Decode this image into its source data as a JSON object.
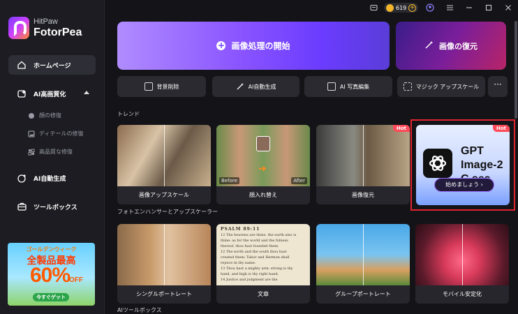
{
  "app": {
    "brand": "HitPaw",
    "product": "FotorPea"
  },
  "topbar": {
    "coins": "619"
  },
  "sidebar": {
    "items": [
      {
        "label": "ホームページ"
      },
      {
        "label": "AI高画質化"
      },
      {
        "label": "AI自動生成"
      },
      {
        "label": "ツールボックス"
      }
    ],
    "subitems": [
      {
        "label": "顔の修復"
      },
      {
        "label": "ディテールの修復"
      },
      {
        "label": "高品質な修復"
      }
    ],
    "promo": {
      "line1": "ゴールデンウィーク",
      "line2": "全製品最高",
      "percent": "60%",
      "off": "OFF",
      "button": "今すぐゲット"
    }
  },
  "main": {
    "hero_primary": "画像処理の開始",
    "hero_secondary": "画像の復元",
    "tools": [
      {
        "label": "背景削除"
      },
      {
        "label": "AI自動生成"
      },
      {
        "label": "AI 写真編集"
      },
      {
        "label": "マジック アップスケール"
      }
    ],
    "more": "···",
    "sections": {
      "trend": "トレンド",
      "enhancer": "フォトエンハンサーとアップスケーラー",
      "ai_toolbox": "AIツールボックス"
    },
    "trend_cards": [
      {
        "label": "画像アップスケール"
      },
      {
        "label": "顔入れ替え",
        "before": "Before",
        "after": "After"
      },
      {
        "label": "画像復元",
        "badge": "Hot"
      }
    ],
    "gpt_card": {
      "badge": "Hot",
      "line1": "GPT",
      "line2": "Image-2",
      "line3": "C  ses",
      "button": "始めましょう ›"
    },
    "enhancer_cards": [
      {
        "label": "シングルポートレート"
      },
      {
        "label": "文章",
        "text_lines": [
          "PSALM 89:11",
          "12 The heavens are thine, the earth also is",
          "thine: as for the world and the fulness",
          "thereof, thou hast founded them.",
          "12 The north and the south thou hast",
          "created them: Tabor and Hermon shall",
          "rejoice in thy name.",
          "13 Thou hast a mighty arm: strong is thy",
          "hand, and high is thy right hand.",
          "14 Justice and judgment are the",
          "habitation of thy throne: mercy and"
        ]
      },
      {
        "label": "グループポートレート"
      },
      {
        "label": "モバイル安定化"
      }
    ]
  }
}
